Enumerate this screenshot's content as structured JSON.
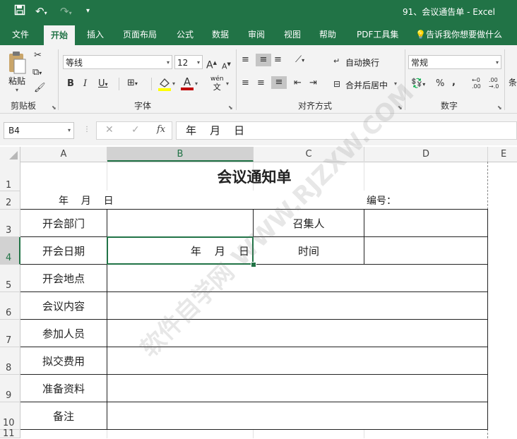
{
  "window": {
    "title": "91、会议通告单 - Excel",
    "save_icon": "save-icon",
    "undo_icon": "undo-icon",
    "redo_icon": "redo-icon"
  },
  "tabs": [
    "文件",
    "开始",
    "插入",
    "页面布局",
    "公式",
    "数据",
    "审阅",
    "视图",
    "帮助",
    "PDF工具集"
  ],
  "tell_me": "告诉我你想要做什么",
  "ribbon": {
    "clipboard": {
      "paste_label": "粘贴",
      "group_label": "剪贴板"
    },
    "font": {
      "font_name": "等线",
      "font_size": "12",
      "grow": "A",
      "shrink": "A",
      "bold": "B",
      "italic": "I",
      "underline": "U",
      "phonetic": "wén",
      "group_label": "字体",
      "fill_color": "#ffff00",
      "font_color": "#c00000"
    },
    "alignment": {
      "wrap_text": "自动换行",
      "merge_center": "合并后居中",
      "group_label": "对齐方式"
    },
    "number": {
      "format": "常规",
      "percent": "%",
      "comma": ",",
      "group_label": "数字"
    },
    "styles_partial": "条"
  },
  "formula_bar": {
    "name_box": "B4",
    "cancel": "✕",
    "enter": "✓",
    "fx": "fx",
    "content": "年    月    日"
  },
  "grid": {
    "columns": [
      "A",
      "B",
      "C",
      "D",
      "E"
    ],
    "rows": [
      "1",
      "2",
      "3",
      "4",
      "5",
      "6",
      "7",
      "8",
      "9",
      "10",
      "11"
    ],
    "title": "会议通知单",
    "date_line": "年    月    日",
    "number_label": "编号：",
    "labels": {
      "dept": "开会部门",
      "convener": "召集人",
      "date": "开会日期",
      "date_value": "年    月    日",
      "time": "时间",
      "place": "开会地点",
      "content": "会议内容",
      "attendees": "参加人员",
      "cost": "拟交费用",
      "materials": "准备资料",
      "remarks": "备注"
    }
  },
  "watermark": "软件自学网 WWW.RJZXW.COM"
}
